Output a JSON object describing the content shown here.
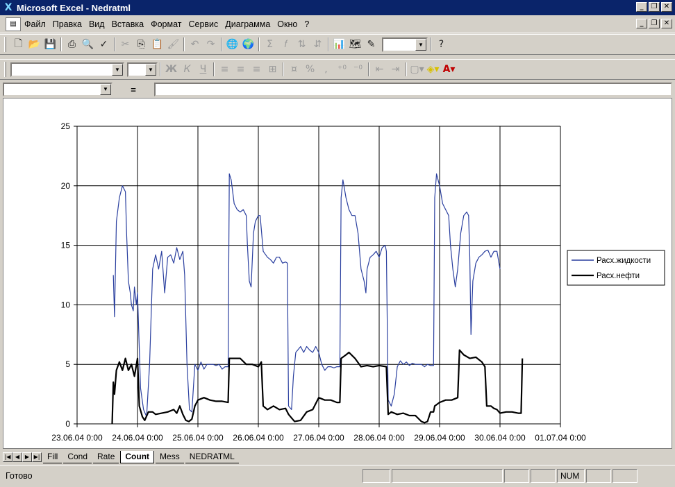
{
  "window": {
    "title": "Microsoft Excel - Nedratml"
  },
  "menu": [
    "Файл",
    "Правка",
    "Вид",
    "Вставка",
    "Формат",
    "Сервис",
    "Диаграмма",
    "Окно",
    "?"
  ],
  "formula_bar": {
    "eq": "="
  },
  "sheet_tabs": [
    {
      "label": "Fill",
      "active": false
    },
    {
      "label": "Cond",
      "active": false
    },
    {
      "label": "Rate",
      "active": false
    },
    {
      "label": "Count",
      "active": true
    },
    {
      "label": "Mess",
      "active": false
    },
    {
      "label": "NEDRATML",
      "active": false
    }
  ],
  "status": {
    "text": "Готово",
    "num": "NUM"
  },
  "chart_data": {
    "type": "line",
    "x_tick_labels": [
      "23.06.04 0:00",
      "24.06.04 0:00",
      "25.06.04 0:00",
      "26.06.04 0:00",
      "27.06.04 0:00",
      "28.06.04 0:00",
      "29.06.04 0:00",
      "30.06.04 0:00",
      "01.07.04 0:00"
    ],
    "x_unit": "days since 23.06.04 0:00 (axis 0–8)",
    "ylim": [
      0,
      25
    ],
    "y_ticks": [
      0,
      5,
      10,
      15,
      20,
      25
    ],
    "grid": true,
    "legend_placement": "right",
    "series": [
      {
        "name": "Расх.жидкости",
        "color": "#2a3f9f",
        "points": [
          [
            0.6,
            12.5
          ],
          [
            0.62,
            9
          ],
          [
            0.65,
            17
          ],
          [
            0.7,
            19
          ],
          [
            0.75,
            20
          ],
          [
            0.8,
            19.5
          ],
          [
            0.82,
            16
          ],
          [
            0.85,
            12
          ],
          [
            0.88,
            11
          ],
          [
            0.9,
            10
          ],
          [
            0.93,
            9.5
          ],
          [
            0.95,
            11.5
          ],
          [
            0.98,
            10
          ],
          [
            1.0,
            11
          ],
          [
            1.05,
            3
          ],
          [
            1.1,
            1.2
          ],
          [
            1.15,
            0.6
          ],
          [
            1.2,
            5
          ],
          [
            1.25,
            13
          ],
          [
            1.3,
            14.2
          ],
          [
            1.35,
            13
          ],
          [
            1.4,
            14.5
          ],
          [
            1.45,
            11
          ],
          [
            1.5,
            14
          ],
          [
            1.55,
            14.2
          ],
          [
            1.6,
            13.5
          ],
          [
            1.65,
            14.8
          ],
          [
            1.7,
            13.8
          ],
          [
            1.75,
            14.5
          ],
          [
            1.78,
            12.5
          ],
          [
            1.82,
            5
          ],
          [
            1.86,
            1.2
          ],
          [
            1.9,
            1.0
          ],
          [
            1.95,
            5
          ],
          [
            2.0,
            4.5
          ],
          [
            2.05,
            5.2
          ],
          [
            2.1,
            4.6
          ],
          [
            2.15,
            5.0
          ],
          [
            2.2,
            5.0
          ],
          [
            2.25,
            5.0
          ],
          [
            2.3,
            4.9
          ],
          [
            2.35,
            5.0
          ],
          [
            2.4,
            4.6
          ],
          [
            2.45,
            4.8
          ],
          [
            2.5,
            4.8
          ],
          [
            2.52,
            21
          ],
          [
            2.55,
            20.5
          ],
          [
            2.6,
            18.5
          ],
          [
            2.65,
            18
          ],
          [
            2.7,
            17.8
          ],
          [
            2.75,
            18
          ],
          [
            2.8,
            17.5
          ],
          [
            2.82,
            15
          ],
          [
            2.85,
            12
          ],
          [
            2.88,
            11.5
          ],
          [
            2.92,
            16
          ],
          [
            2.95,
            17
          ],
          [
            3.0,
            17.5
          ],
          [
            3.03,
            17.5
          ],
          [
            3.08,
            14.5
          ],
          [
            3.15,
            14
          ],
          [
            3.2,
            13.8
          ],
          [
            3.25,
            13.5
          ],
          [
            3.3,
            14
          ],
          [
            3.35,
            14
          ],
          [
            3.4,
            13.5
          ],
          [
            3.45,
            13.6
          ],
          [
            3.48,
            13.5
          ],
          [
            3.5,
            1.5
          ],
          [
            3.55,
            1.2
          ],
          [
            3.58,
            4
          ],
          [
            3.62,
            6
          ],
          [
            3.7,
            6.5
          ],
          [
            3.75,
            6
          ],
          [
            3.8,
            6.5
          ],
          [
            3.85,
            6.2
          ],
          [
            3.9,
            6
          ],
          [
            3.95,
            6.5
          ],
          [
            4.0,
            6
          ],
          [
            4.05,
            5
          ],
          [
            4.1,
            4.5
          ],
          [
            4.15,
            4.8
          ],
          [
            4.2,
            4.8
          ],
          [
            4.25,
            4.7
          ],
          [
            4.3,
            4.8
          ],
          [
            4.35,
            4.8
          ],
          [
            4.37,
            19
          ],
          [
            4.4,
            20.5
          ],
          [
            4.45,
            19
          ],
          [
            4.5,
            18
          ],
          [
            4.55,
            17.5
          ],
          [
            4.6,
            17.5
          ],
          [
            4.65,
            16
          ],
          [
            4.7,
            13
          ],
          [
            4.75,
            12
          ],
          [
            4.78,
            11
          ],
          [
            4.8,
            13
          ],
          [
            4.85,
            14
          ],
          [
            4.9,
            14.2
          ],
          [
            4.95,
            14.5
          ],
          [
            5.0,
            14
          ],
          [
            5.05,
            14.8
          ],
          [
            5.1,
            15
          ],
          [
            5.12,
            14.5
          ],
          [
            5.15,
            2
          ],
          [
            5.2,
            1.5
          ],
          [
            5.25,
            2.5
          ],
          [
            5.3,
            4.8
          ],
          [
            5.35,
            5.3
          ],
          [
            5.4,
            5
          ],
          [
            5.45,
            5.2
          ],
          [
            5.5,
            4.9
          ],
          [
            5.55,
            5.1
          ],
          [
            5.6,
            5
          ],
          [
            5.65,
            5
          ],
          [
            5.7,
            5
          ],
          [
            5.75,
            4.8
          ],
          [
            5.8,
            5
          ],
          [
            5.85,
            4.9
          ],
          [
            5.9,
            4.9
          ],
          [
            5.92,
            19
          ],
          [
            5.95,
            21
          ],
          [
            6.0,
            20
          ],
          [
            6.05,
            18.5
          ],
          [
            6.1,
            18
          ],
          [
            6.15,
            17.5
          ],
          [
            6.18,
            15
          ],
          [
            6.22,
            13
          ],
          [
            6.26,
            11.5
          ],
          [
            6.3,
            13
          ],
          [
            6.35,
            16
          ],
          [
            6.4,
            17.5
          ],
          [
            6.45,
            17.8
          ],
          [
            6.48,
            17.5
          ],
          [
            6.5,
            14
          ],
          [
            6.52,
            7.5
          ],
          [
            6.55,
            12
          ],
          [
            6.6,
            13.5
          ],
          [
            6.65,
            14
          ],
          [
            6.7,
            14.2
          ],
          [
            6.75,
            14.5
          ],
          [
            6.8,
            14.6
          ],
          [
            6.85,
            14
          ],
          [
            6.9,
            14.5
          ],
          [
            6.95,
            14.5
          ],
          [
            7.0,
            13
          ]
        ]
      },
      {
        "name": "Расх.нефти",
        "color": "#000000",
        "points": [
          [
            0.58,
            0
          ],
          [
            0.6,
            3.5
          ],
          [
            0.62,
            2.5
          ],
          [
            0.65,
            4.5
          ],
          [
            0.7,
            5.2
          ],
          [
            0.75,
            4.5
          ],
          [
            0.8,
            5.5
          ],
          [
            0.85,
            4.5
          ],
          [
            0.9,
            5
          ],
          [
            0.95,
            4
          ],
          [
            1.0,
            5.5
          ],
          [
            1.03,
            1.5
          ],
          [
            1.08,
            0.6
          ],
          [
            1.12,
            0.3
          ],
          [
            1.18,
            1.0
          ],
          [
            1.25,
            1.0
          ],
          [
            1.3,
            0.8
          ],
          [
            1.4,
            0.9
          ],
          [
            1.5,
            1.0
          ],
          [
            1.6,
            1.2
          ],
          [
            1.65,
            0.9
          ],
          [
            1.7,
            1.5
          ],
          [
            1.75,
            0.8
          ],
          [
            1.8,
            0.3
          ],
          [
            1.85,
            0.2
          ],
          [
            1.9,
            0.4
          ],
          [
            1.95,
            1.5
          ],
          [
            2.0,
            2.0
          ],
          [
            2.1,
            2.2
          ],
          [
            2.2,
            2.0
          ],
          [
            2.3,
            1.9
          ],
          [
            2.4,
            1.9
          ],
          [
            2.5,
            1.8
          ],
          [
            2.52,
            5.5
          ],
          [
            2.6,
            5.5
          ],
          [
            2.7,
            5.5
          ],
          [
            2.8,
            5.0
          ],
          [
            2.9,
            5.0
          ],
          [
            3.0,
            4.8
          ],
          [
            3.05,
            5.2
          ],
          [
            3.08,
            1.5
          ],
          [
            3.15,
            1.2
          ],
          [
            3.25,
            1.5
          ],
          [
            3.35,
            1.2
          ],
          [
            3.45,
            1.3
          ],
          [
            3.5,
            0.8
          ],
          [
            3.55,
            0.5
          ],
          [
            3.6,
            0.2
          ],
          [
            3.7,
            0.3
          ],
          [
            3.8,
            1.0
          ],
          [
            3.9,
            1.2
          ],
          [
            4.0,
            2.2
          ],
          [
            4.1,
            2.0
          ],
          [
            4.2,
            2.0
          ],
          [
            4.3,
            1.8
          ],
          [
            4.35,
            1.8
          ],
          [
            4.37,
            5.5
          ],
          [
            4.45,
            5.8
          ],
          [
            4.5,
            6
          ],
          [
            4.6,
            5.5
          ],
          [
            4.7,
            4.8
          ],
          [
            4.8,
            4.9
          ],
          [
            4.9,
            4.8
          ],
          [
            5.0,
            4.9
          ],
          [
            5.12,
            4.8
          ],
          [
            5.15,
            0.8
          ],
          [
            5.2,
            1.0
          ],
          [
            5.3,
            0.8
          ],
          [
            5.4,
            0.9
          ],
          [
            5.5,
            0.7
          ],
          [
            5.6,
            0.7
          ],
          [
            5.7,
            0.2
          ],
          [
            5.75,
            0.1
          ],
          [
            5.8,
            0.2
          ],
          [
            5.85,
            1.0
          ],
          [
            5.9,
            1.0
          ],
          [
            5.92,
            1.5
          ],
          [
            6.0,
            1.8
          ],
          [
            6.1,
            2.0
          ],
          [
            6.2,
            2.0
          ],
          [
            6.3,
            2.2
          ],
          [
            6.33,
            6.2
          ],
          [
            6.4,
            5.8
          ],
          [
            6.5,
            5.5
          ],
          [
            6.6,
            5.6
          ],
          [
            6.7,
            5.2
          ],
          [
            6.75,
            4.8
          ],
          [
            6.78,
            1.5
          ],
          [
            6.85,
            1.5
          ],
          [
            6.9,
            1.3
          ],
          [
            6.95,
            1.2
          ],
          [
            7.0,
            0.9
          ],
          [
            7.1,
            1.0
          ],
          [
            7.2,
            1.0
          ],
          [
            7.3,
            0.9
          ],
          [
            7.35,
            0.9
          ],
          [
            7.37,
            5.5
          ]
        ]
      }
    ]
  }
}
